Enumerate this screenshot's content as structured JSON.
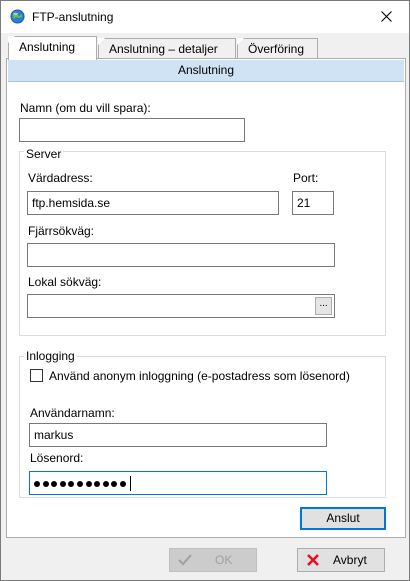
{
  "window": {
    "title": "FTP-anslutning"
  },
  "tabs": [
    {
      "label": "Anslutning",
      "active": true
    },
    {
      "label": "Anslutning – detaljer",
      "active": false
    },
    {
      "label": "Överföring",
      "active": false
    }
  ],
  "panel": {
    "header": "Anslutning",
    "name_label": "Namn (om du vill spara):",
    "name_value": "",
    "server": {
      "legend": "Server",
      "host_label": "Värdadress:",
      "host_value": "ftp.hemsida.se",
      "port_label": "Port:",
      "port_value": "21",
      "remote_path_label": "Fjärrsökväg:",
      "remote_path_value": "",
      "local_path_label": "Lokal sökväg:",
      "local_path_value": "",
      "browse_label": "..."
    },
    "login": {
      "legend": "Inlogging",
      "anonymous_label": "Använd anonym inloggning (e-postadress som lösenord)",
      "anonymous_checked": false,
      "username_label": "Användarnamn:",
      "username_value": "markus",
      "password_label": "Lösenord:",
      "password_length": 11
    },
    "connect_button": "Anslut"
  },
  "footer": {
    "ok_label": "OK",
    "cancel_label": "Avbryt"
  },
  "colors": {
    "accent": "#0078d7",
    "header_bg": "#cfe3f5",
    "cancel_icon": "#e81123",
    "ok_icon_disabled": "#a0a0a0"
  },
  "icons": {
    "app": "globe-icon",
    "close": "close-icon",
    "ok": "checkmark-icon",
    "cancel": "red-x-icon"
  }
}
